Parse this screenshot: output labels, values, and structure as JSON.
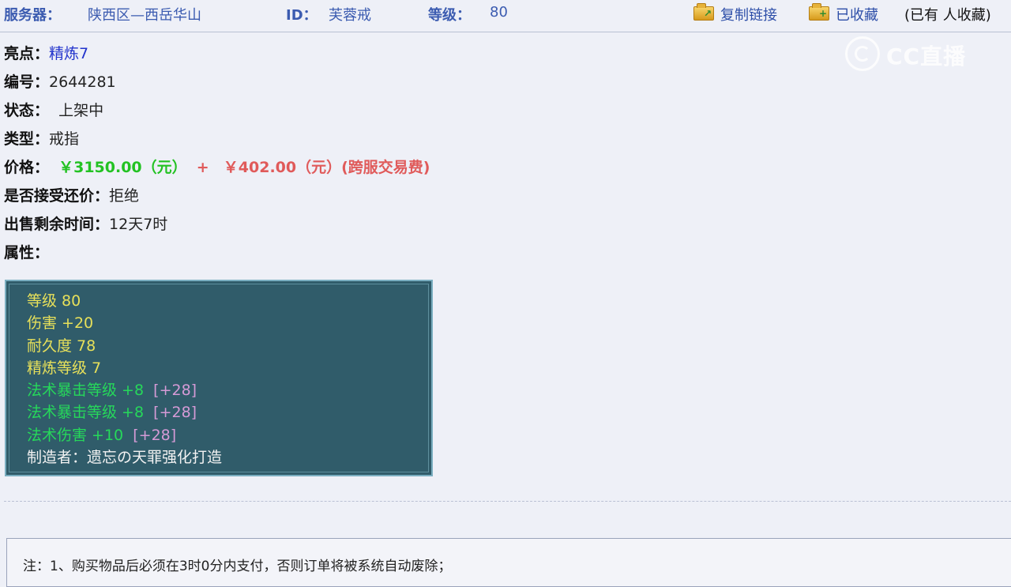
{
  "header": {
    "server_label": "服务器：",
    "server_value": "陕西区—西岳华山",
    "id_label": "ID：",
    "id_value": "芙蓉戒",
    "level_label": "等级：",
    "level_value": "80",
    "copy_link": "复制链接",
    "favorited": "已收藏",
    "favorite_count": "(已有 人收藏)"
  },
  "watermark": {
    "text": "CC直播",
    "icon": "cc-logo-icon"
  },
  "item": {
    "highlight_label": "亮点：",
    "highlight_value": "精炼7",
    "number_label": "编号：",
    "number_value": "2644281",
    "status_label": "状态：",
    "status_value": "上架中",
    "type_label": "类型：",
    "type_value": "戒指",
    "price_label": "价格：",
    "price_main": "￥3150.00（元）",
    "price_plus": "+",
    "price_fee": "￥402.00（元）(跨服交易费)",
    "counter_offer_label": "是否接受还价：",
    "counter_offer_value": "拒绝",
    "remaining_label": "出售剩余时间：",
    "remaining_value": "12天7时",
    "attributes_label": "属性："
  },
  "attributes": [
    {
      "text": "等级 80"
    },
    {
      "text": "伤害 +20"
    },
    {
      "text": "耐久度 78"
    },
    {
      "text": "精炼等级 7"
    },
    {
      "text": "法术暴击等级 +8",
      "bonus": "[+28]"
    },
    {
      "text": "法术暴击等级 +8",
      "bonus": "[+28]"
    },
    {
      "text": "法术伤害 +10",
      "bonus": "[+28]"
    },
    {
      "text": "制造者：遗忘の天罪强化打造"
    }
  ],
  "notice": {
    "text": "注：1、购买物品后必须在3时0分内支付，否则订单将被系统自动废除；"
  },
  "colors": {
    "background": "#eef0f7",
    "header_blue": "#3b5bb0",
    "price_green": "#23c223",
    "price_red": "#e05a5a",
    "attr_box": "#305c6a",
    "attr_yellow": "#e7e05a",
    "attr_green": "#26d85a",
    "attr_purple": "#d59ad6"
  }
}
